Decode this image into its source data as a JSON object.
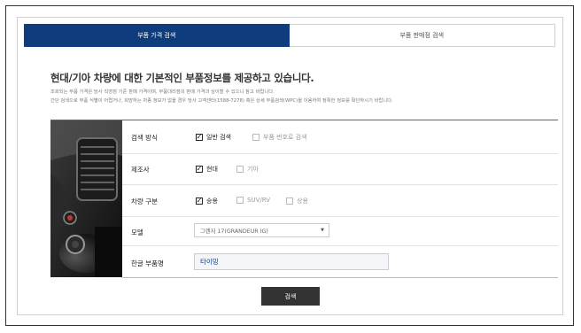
{
  "tabs": [
    {
      "label": "부품 가격 검색",
      "active": true
    },
    {
      "label": "부품 판매점 검색",
      "active": false
    }
  ],
  "heading": "현대/기아 차량에 대한 기본적인 부품정보를 제공하고 있습니다.",
  "description": [
    "조회되는 부품 가격은 당사 직영점 기준 판매 가격이며, 부품대리점의 판매 가격과 상이할 수 있으니 참고 바랍니다.",
    "간단 검색으로 부품 식별이 어렵거나, 희망하는 차종 정보가 없을 경우 당사 고객센터(1588-7278) 혹은 상세 부품검색(WPC)을 이용하여 정확한 정보를 확인하시기 바랍니다."
  ],
  "form": {
    "search_method": {
      "label": "검색 방식",
      "options": [
        {
          "label": "일반 검색",
          "checked": true
        },
        {
          "label": "부품 번호로 검색",
          "checked": false
        }
      ]
    },
    "manufacturer": {
      "label": "제조사",
      "options": [
        {
          "label": "현대",
          "checked": true
        },
        {
          "label": "기아",
          "checked": false
        }
      ]
    },
    "vehicle_type": {
      "label": "차량 구분",
      "options": [
        {
          "label": "승용",
          "checked": true
        },
        {
          "label": "SUV/RV",
          "checked": false
        },
        {
          "label": "상용",
          "checked": false
        }
      ]
    },
    "model": {
      "label": "모델",
      "selected": "그랜저 17(GRANDEUR IG)"
    },
    "part_name": {
      "label": "한글 부품명",
      "value": "타이밍"
    }
  },
  "search_button": "검색",
  "colors": {
    "accent": "#0f3c7d",
    "button": "#333333"
  }
}
